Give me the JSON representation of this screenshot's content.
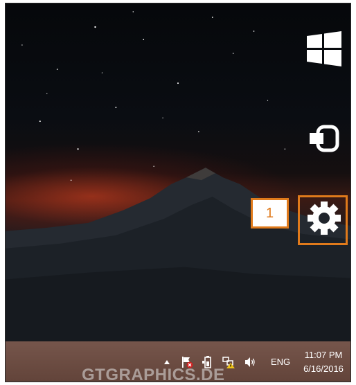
{
  "charms": {
    "start": {
      "icon": "windows-logo-icon"
    },
    "devices": {
      "icon": "devices-icon"
    },
    "settings": {
      "icon": "gear-icon"
    }
  },
  "callout": {
    "number": "1",
    "color": "#e07a1b"
  },
  "taskbar": {
    "tray_icons": [
      "chevron-up-icon",
      "action-center-flag-icon",
      "battery-icon",
      "network-icon",
      "volume-icon"
    ],
    "language": "ENG",
    "time": "11:07 PM",
    "date": "6/16/2016",
    "color": "#6d4b40"
  },
  "watermark": "GTGRAPHICS.DE"
}
